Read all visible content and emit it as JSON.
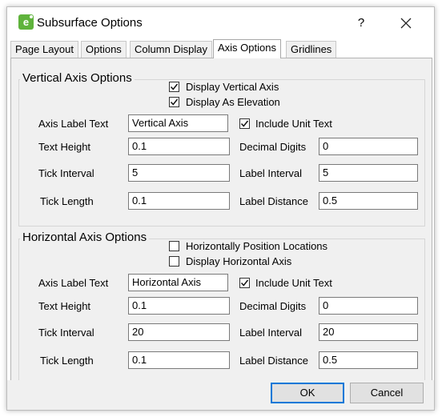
{
  "title": "Subsurface Options",
  "title_help": "?",
  "tabs": [
    {
      "label": "Page Layout",
      "active": false
    },
    {
      "label": "Options",
      "active": false
    },
    {
      "label": "Column Display",
      "active": false
    },
    {
      "label": "Axis Options",
      "active": true
    },
    {
      "label": "Gridlines",
      "active": false
    }
  ],
  "vertical": {
    "title": "Vertical Axis Options",
    "display_axis": {
      "label": "Display Vertical Axis",
      "checked": true
    },
    "display_elevation": {
      "label": "Display As Elevation",
      "checked": true
    },
    "axis_label_text": {
      "label": "Axis Label Text",
      "value": "Vertical Axis"
    },
    "include_unit_text": {
      "label": "Include Unit Text",
      "checked": true
    },
    "text_height": {
      "label": "Text Height",
      "value": "0.1"
    },
    "decimal_digits": {
      "label": "Decimal Digits",
      "value": "0"
    },
    "tick_interval": {
      "label": "Tick Interval",
      "value": "5"
    },
    "label_interval": {
      "label": "Label Interval",
      "value": "5"
    },
    "tick_length": {
      "label": "Tick Length",
      "value": "0.1"
    },
    "label_distance": {
      "label": "Label Distance",
      "value": "0.5"
    }
  },
  "horizontal": {
    "title": "Horizontal Axis Options",
    "position_locations": {
      "label": "Horizontally Position Locations",
      "checked": false
    },
    "display_axis": {
      "label": "Display Horizontal Axis",
      "checked": false
    },
    "axis_label_text": {
      "label": "Axis Label Text",
      "value": "Horizontal Axis"
    },
    "include_unit_text": {
      "label": "Include Unit Text",
      "checked": true
    },
    "text_height": {
      "label": "Text Height",
      "value": "0.1"
    },
    "decimal_digits": {
      "label": "Decimal Digits",
      "value": "0"
    },
    "tick_interval": {
      "label": "Tick Interval",
      "value": "20"
    },
    "label_interval": {
      "label": "Label Interval",
      "value": "20"
    },
    "tick_length": {
      "label": "Tick Length",
      "value": "0.1"
    },
    "label_distance": {
      "label": "Label Distance",
      "value": "0.5"
    }
  },
  "buttons": {
    "ok": "OK",
    "cancel": "Cancel"
  },
  "colors": {
    "accent": "#0078d7",
    "app_icon": "#5fb33c",
    "panel": "#f0f0f0"
  }
}
